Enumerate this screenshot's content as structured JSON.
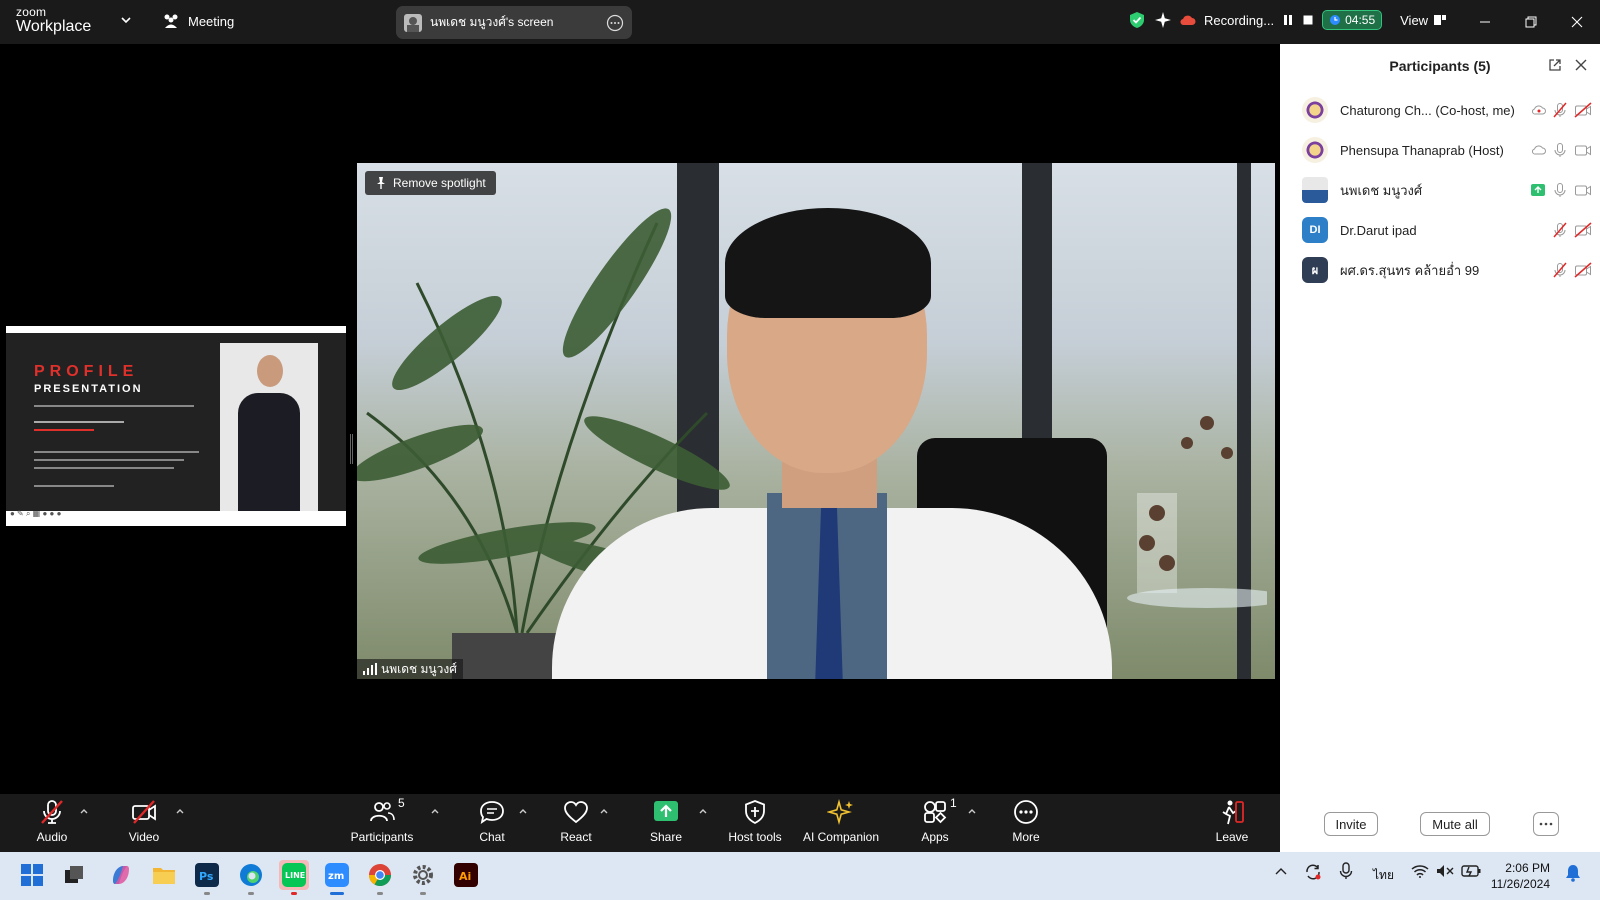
{
  "titlebar": {
    "brand_small": "zoom",
    "brand_big": "Workplace",
    "meeting_label": "Meeting",
    "screen_label": "นพเดช มนูวงศ์'s screen",
    "recording_label": "Recording...",
    "timer": "04:55",
    "view_label": "View"
  },
  "stage": {
    "slide_title": "PROFILE",
    "slide_subtitle": "PRESENTATION",
    "spotlight_label": "Remove spotlight",
    "speaker_name": "นพเดช มนูวงศ์"
  },
  "toolbar": {
    "audio": "Audio",
    "video": "Video",
    "participants": "Participants",
    "participants_count": "5",
    "chat": "Chat",
    "react": "React",
    "share": "Share",
    "host_tools": "Host tools",
    "ai_companion": "AI Companion",
    "apps": "Apps",
    "apps_count": "1",
    "more": "More",
    "leave": "Leave"
  },
  "panel": {
    "title": "Participants (5)",
    "participants": [
      {
        "name": "Chaturong Ch...  (Co-host, me)",
        "avatar": "logo",
        "initials": "",
        "mic": "muted",
        "cam": "off"
      },
      {
        "name": "Phensupa Thanaprab (Host)",
        "avatar": "logo",
        "initials": "",
        "mic": "on",
        "cam": "on"
      },
      {
        "name": "นพเดช มนูวงศ์",
        "avatar": "photo",
        "initials": "",
        "mic": "on",
        "cam": "on"
      },
      {
        "name": "Dr.Darut ipad",
        "avatar": "initials",
        "initials": "DI",
        "mic": "muted",
        "cam": "off"
      },
      {
        "name": "ผศ.ดร.สุนทร คล้ายอ่ำ 99",
        "avatar": "initials",
        "initials": "ผ",
        "mic": "muted",
        "cam": "off"
      }
    ],
    "invite": "Invite",
    "mute_all": "Mute all"
  },
  "taskbar": {
    "lang": "ไทย",
    "time": "2:06 PM",
    "date": "11/26/2024"
  },
  "colors": {
    "accent_green": "#31c27c",
    "danger_red": "#e02828",
    "dark_bg": "#1a1a1a",
    "panel_bg": "#ffffff"
  }
}
